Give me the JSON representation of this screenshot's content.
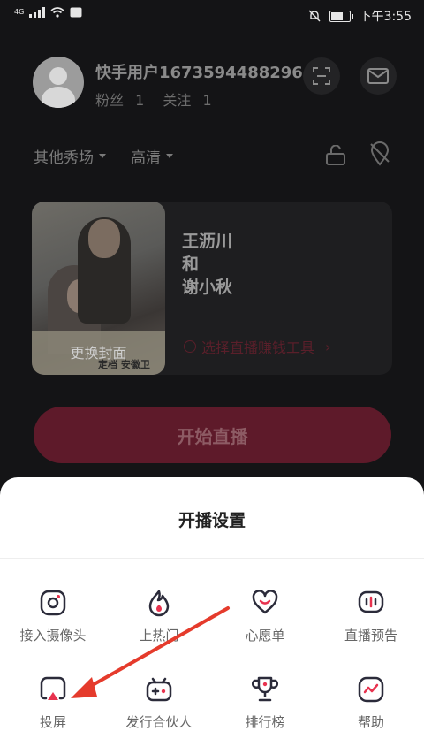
{
  "status": {
    "network": "4G",
    "time": "下午3:55"
  },
  "profile": {
    "username": "快手用户1673594488296",
    "fans_label": "粉丝",
    "fans_count": "1",
    "follow_label": "关注",
    "follow_count": "1"
  },
  "options": {
    "category": "其他秀场",
    "quality": "高清"
  },
  "live_card": {
    "cover_change_label": "更换封面",
    "cover_stamp": "定档 安徽卫",
    "title_lines": [
      "王沥川",
      "和",
      "谢小秋"
    ],
    "earn_tool_label": "选择直播赚钱工具"
  },
  "start_button": "开始直播",
  "sheet": {
    "title": "开播设置",
    "items": [
      {
        "label": "接入摄像头",
        "icon": "camera-icon"
      },
      {
        "label": "上热门",
        "icon": "flame-icon"
      },
      {
        "label": "心愿单",
        "icon": "heart-icon"
      },
      {
        "label": "直播预告",
        "icon": "preview-icon"
      },
      {
        "label": "投屏",
        "icon": "cast-icon"
      },
      {
        "label": "发行合伙人",
        "icon": "gamepad-icon"
      },
      {
        "label": "排行榜",
        "icon": "trophy-icon"
      },
      {
        "label": "帮助",
        "icon": "help-icon"
      }
    ]
  },
  "colors": {
    "accent": "#e8334f",
    "icon": "#2b2b3a",
    "arrow": "#e53b2c"
  }
}
